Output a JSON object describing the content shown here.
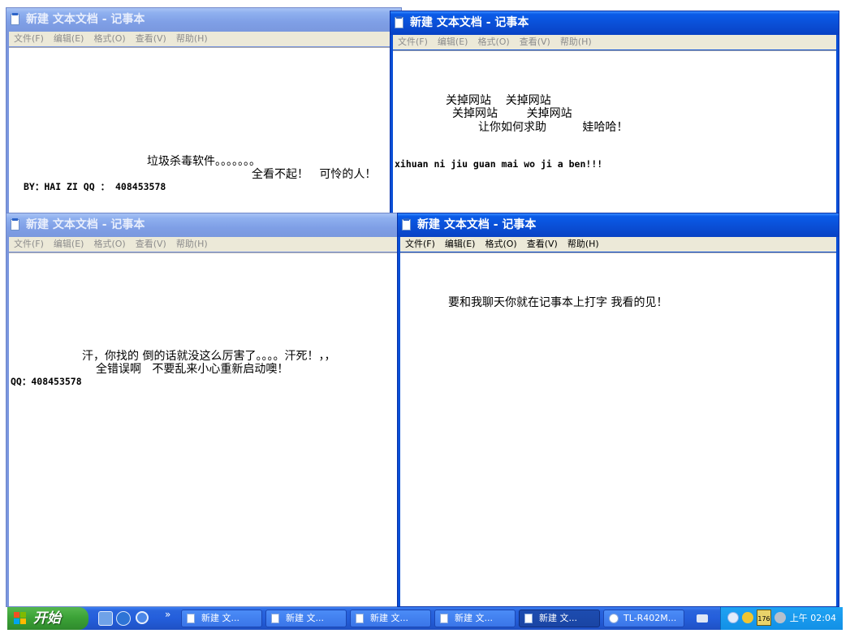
{
  "windows": {
    "tl": {
      "title": "新建 文本文档 - 记事本",
      "menu": [
        "文件(F)",
        "编辑(E)",
        "格式(O)",
        "查看(V)",
        "帮助(H)"
      ],
      "lines": [
        "垃圾杀毒软件。。。。。。。",
        "全看不起！   可怜的人！"
      ],
      "mono": "BY：HAI ZI QQ ： 408453578"
    },
    "tr": {
      "title": "新建 文本文档 - 记事本",
      "menu": [
        "文件(F)",
        "编辑(E)",
        "格式(O)",
        "查看(V)",
        "帮助(H)"
      ],
      "lines": [
        "关掉网站    关掉网站",
        "关掉网站        关掉网站",
        "让你如何求助          娃哈哈！"
      ],
      "mono": "xihuan ni jiu guan mai wo ji a ben!!!"
    },
    "bl": {
      "title": "新建 文本文档 - 记事本",
      "menu": [
        "文件(F)",
        "编辑(E)",
        "格式(O)",
        "查看(V)",
        "帮助(H)"
      ],
      "lines": [
        "汗，你找的 倒的话就没这么厉害了。。。。汗死！，，",
        "全错误啊   不要乱来小心重新启动噢！"
      ],
      "mono": "QQ：408453578"
    },
    "br": {
      "title": "新建 文本文档 - 记事本",
      "menu": [
        "文件(F)",
        "编辑(E)",
        "格式(O)",
        "查看(V)",
        "帮助(H)"
      ],
      "lines": [
        "要和我聊天你就在记事本上打字 我看的见！"
      ]
    }
  },
  "taskbar": {
    "start_label": "开始",
    "more_indicator": "»",
    "buttons": [
      "新建 文...",
      "新建 文...",
      "新建 文...",
      "新建 文...",
      "新建 文...",
      "TL-R402M..."
    ],
    "active_index": 4,
    "tray_number": "176",
    "clock": "上午 02:04"
  },
  "icons": {
    "quicklaunch": [
      "desktop-icon",
      "ie-icon",
      "network-icon"
    ],
    "tray": [
      "keyboard-icon",
      "arrow-left-icon",
      "shield-icon",
      "battery-icon",
      "volume-icon"
    ]
  },
  "colors": {
    "title_active": "#0a4fd6",
    "title_inactive": "#7a96df",
    "taskbar": "#245edb",
    "start": "#3ca337",
    "tray": "#1290e6"
  }
}
